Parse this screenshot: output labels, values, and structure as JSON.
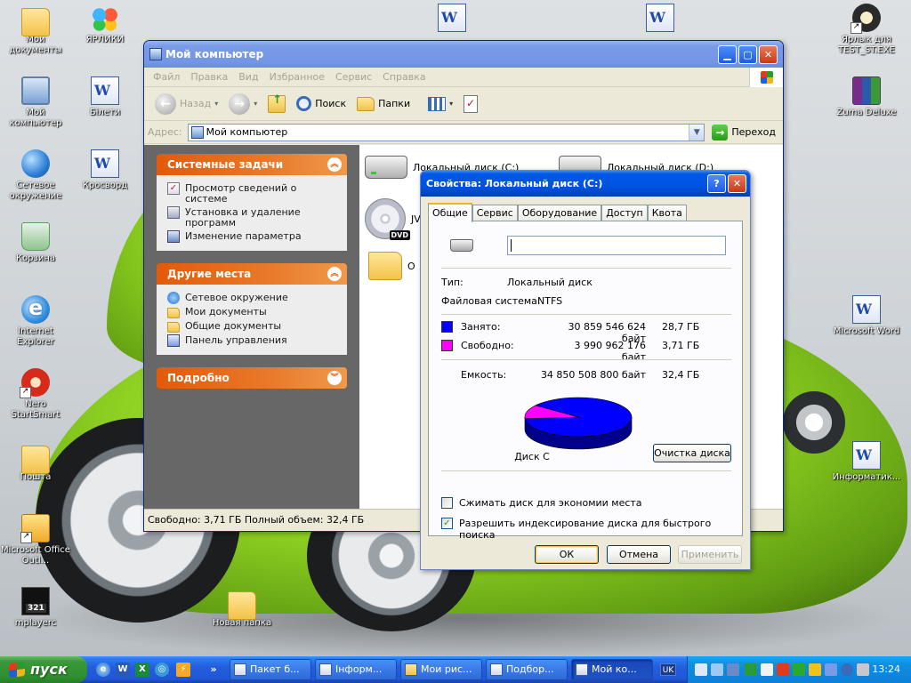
{
  "desktop": {
    "icons": [
      {
        "label": "Мои документы",
        "icon": "my-documents-icon"
      },
      {
        "label": "ЯРЛИКИ",
        "icon": "butterfly-icon"
      },
      {
        "label": "Мой компьютер",
        "icon": "my-computer-icon"
      },
      {
        "label": "Бiлети",
        "icon": "word-document-icon"
      },
      {
        "label": "Сетевое окружение",
        "icon": "network-icon"
      },
      {
        "label": "Кросворд",
        "icon": "word-document-icon"
      },
      {
        "label": "Корзина",
        "icon": "recycle-bin-icon"
      },
      {
        "label": "Internet Explorer",
        "icon": "internet-explorer-icon"
      },
      {
        "label": "Nero StartSmart",
        "icon": "nero-icon"
      },
      {
        "label": "Пошта",
        "icon": "folder-icon"
      },
      {
        "label": "Microsoft Office Outl...",
        "icon": "outlook-icon"
      },
      {
        "label": "mplayerc",
        "icon": "media-player-icon"
      },
      {
        "label": "Новая папка",
        "icon": "folder-icon"
      },
      {
        "label": "Ярлык для TEST_ST.EXE",
        "icon": "exe-icon"
      },
      {
        "label": "Zuma Deluxe",
        "icon": "winrar-icon"
      },
      {
        "label": "Microsoft Word",
        "icon": "word-document-icon"
      },
      {
        "label": "Информатик...",
        "icon": "word-document-icon"
      }
    ]
  },
  "explorer": {
    "title": "Мой компьютер",
    "menu": [
      "Файл",
      "Правка",
      "Вид",
      "Избранное",
      "Сервис",
      "Справка"
    ],
    "toolbar": {
      "back": "Назад",
      "search": "Поиск",
      "folders": "Папки"
    },
    "address": {
      "label": "Адрес:",
      "value": "Мой компьютер",
      "go": "Переход"
    },
    "system_tasks": {
      "title": "Системные задачи",
      "items": [
        "Просмотр сведений о системе",
        "Установка и удаление программ",
        "Изменение параметра"
      ]
    },
    "other_places": {
      "title": "Другие места",
      "items": [
        "Сетевое окружение",
        "Мои документы",
        "Общие документы",
        "Панель управления"
      ]
    },
    "details": {
      "title": "Подробно"
    },
    "files": [
      {
        "label": "Локальный диск (C:)"
      },
      {
        "label": "Локальный диск (D:)"
      },
      {
        "label": "JV"
      },
      {
        "label": "О"
      }
    ],
    "status": "Свободно: 3,71 ГБ Полный объем: 32,4 ГБ"
  },
  "props": {
    "title": "Свойства: Локальный диск (C:)",
    "tabs": [
      "Общие",
      "Сервис",
      "Оборудование",
      "Доступ",
      "Квота"
    ],
    "volume_label": "",
    "type_label": "Тип:",
    "type_value": "Локальный диск",
    "fs_label": "Файловая система:",
    "fs_value": "NTFS",
    "used_label": "Занято:",
    "used_bytes": "30 859 546 624 байт",
    "used_gb": "28,7 ГБ",
    "free_label": "Свободно:",
    "free_bytes": "3 990 962 176 байт",
    "free_gb": "3,71 ГБ",
    "capacity_label": "Емкость:",
    "capacity_bytes": "34 850 508 800 байт",
    "capacity_gb": "32,4 ГБ",
    "disk_caption": "Диск С",
    "cleanup": "Очистка диска",
    "compress": "Сжимать диск для экономии места",
    "compress_checked": false,
    "index": "Разрешить индексирование диска для быстрого поиска",
    "index_checked": true,
    "ok": "ОК",
    "cancel": "Отмена",
    "apply": "Применить",
    "colors": {
      "used": "#0000ff",
      "free": "#ff00ff"
    },
    "pie": {
      "used_bytes": 30859546624,
      "free_bytes": 3990962176
    }
  },
  "taskbar": {
    "start": "пуск",
    "tasks": [
      "Пакет б...",
      "Інформ...",
      "Мои рис...",
      "Подбор...",
      "Мой ко..."
    ],
    "lang": "UK",
    "clock": "13:24"
  }
}
